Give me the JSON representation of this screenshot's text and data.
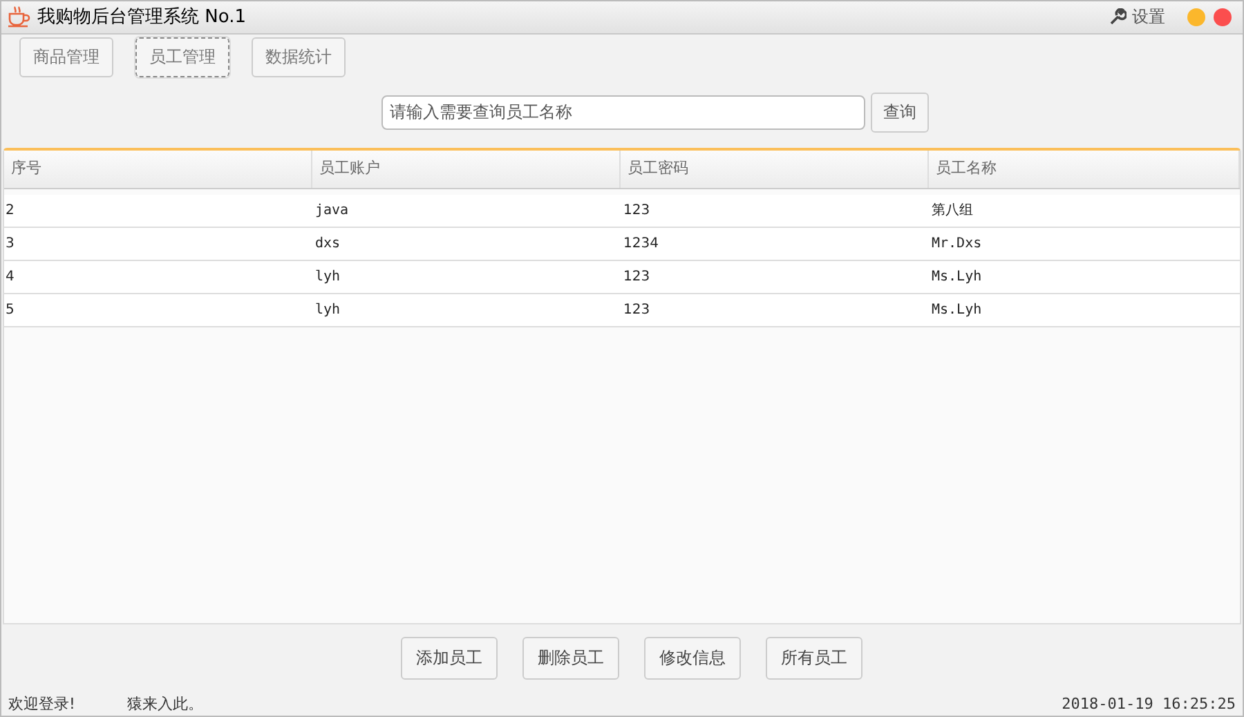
{
  "window": {
    "title": "我购物后台管理系统 No.1",
    "settings": "设置"
  },
  "tabs": [
    {
      "label": "商品管理",
      "selected": false
    },
    {
      "label": "员工管理",
      "selected": true
    },
    {
      "label": "数据统计",
      "selected": false
    }
  ],
  "search": {
    "placeholder": "请输入需要查询员工名称",
    "button": "查询"
  },
  "table": {
    "columns": [
      "序号",
      "员工账户",
      "员工密码",
      "员工名称"
    ],
    "rows": [
      [
        "2",
        "java",
        "123",
        "第八组"
      ],
      [
        "3",
        "dxs",
        "1234",
        "Mr.Dxs"
      ],
      [
        "4",
        "lyh",
        "123",
        "Ms.Lyh"
      ],
      [
        "5",
        "lyh",
        "123",
        "Ms.Lyh"
      ]
    ]
  },
  "buttons": [
    "添加员工",
    "删除员工",
    "修改信息",
    "所有员工"
  ],
  "status_bar": {
    "welcome": "欢迎登录!",
    "user": "猿来入此。",
    "datetime": "2018-01-19 16:25:25"
  }
}
